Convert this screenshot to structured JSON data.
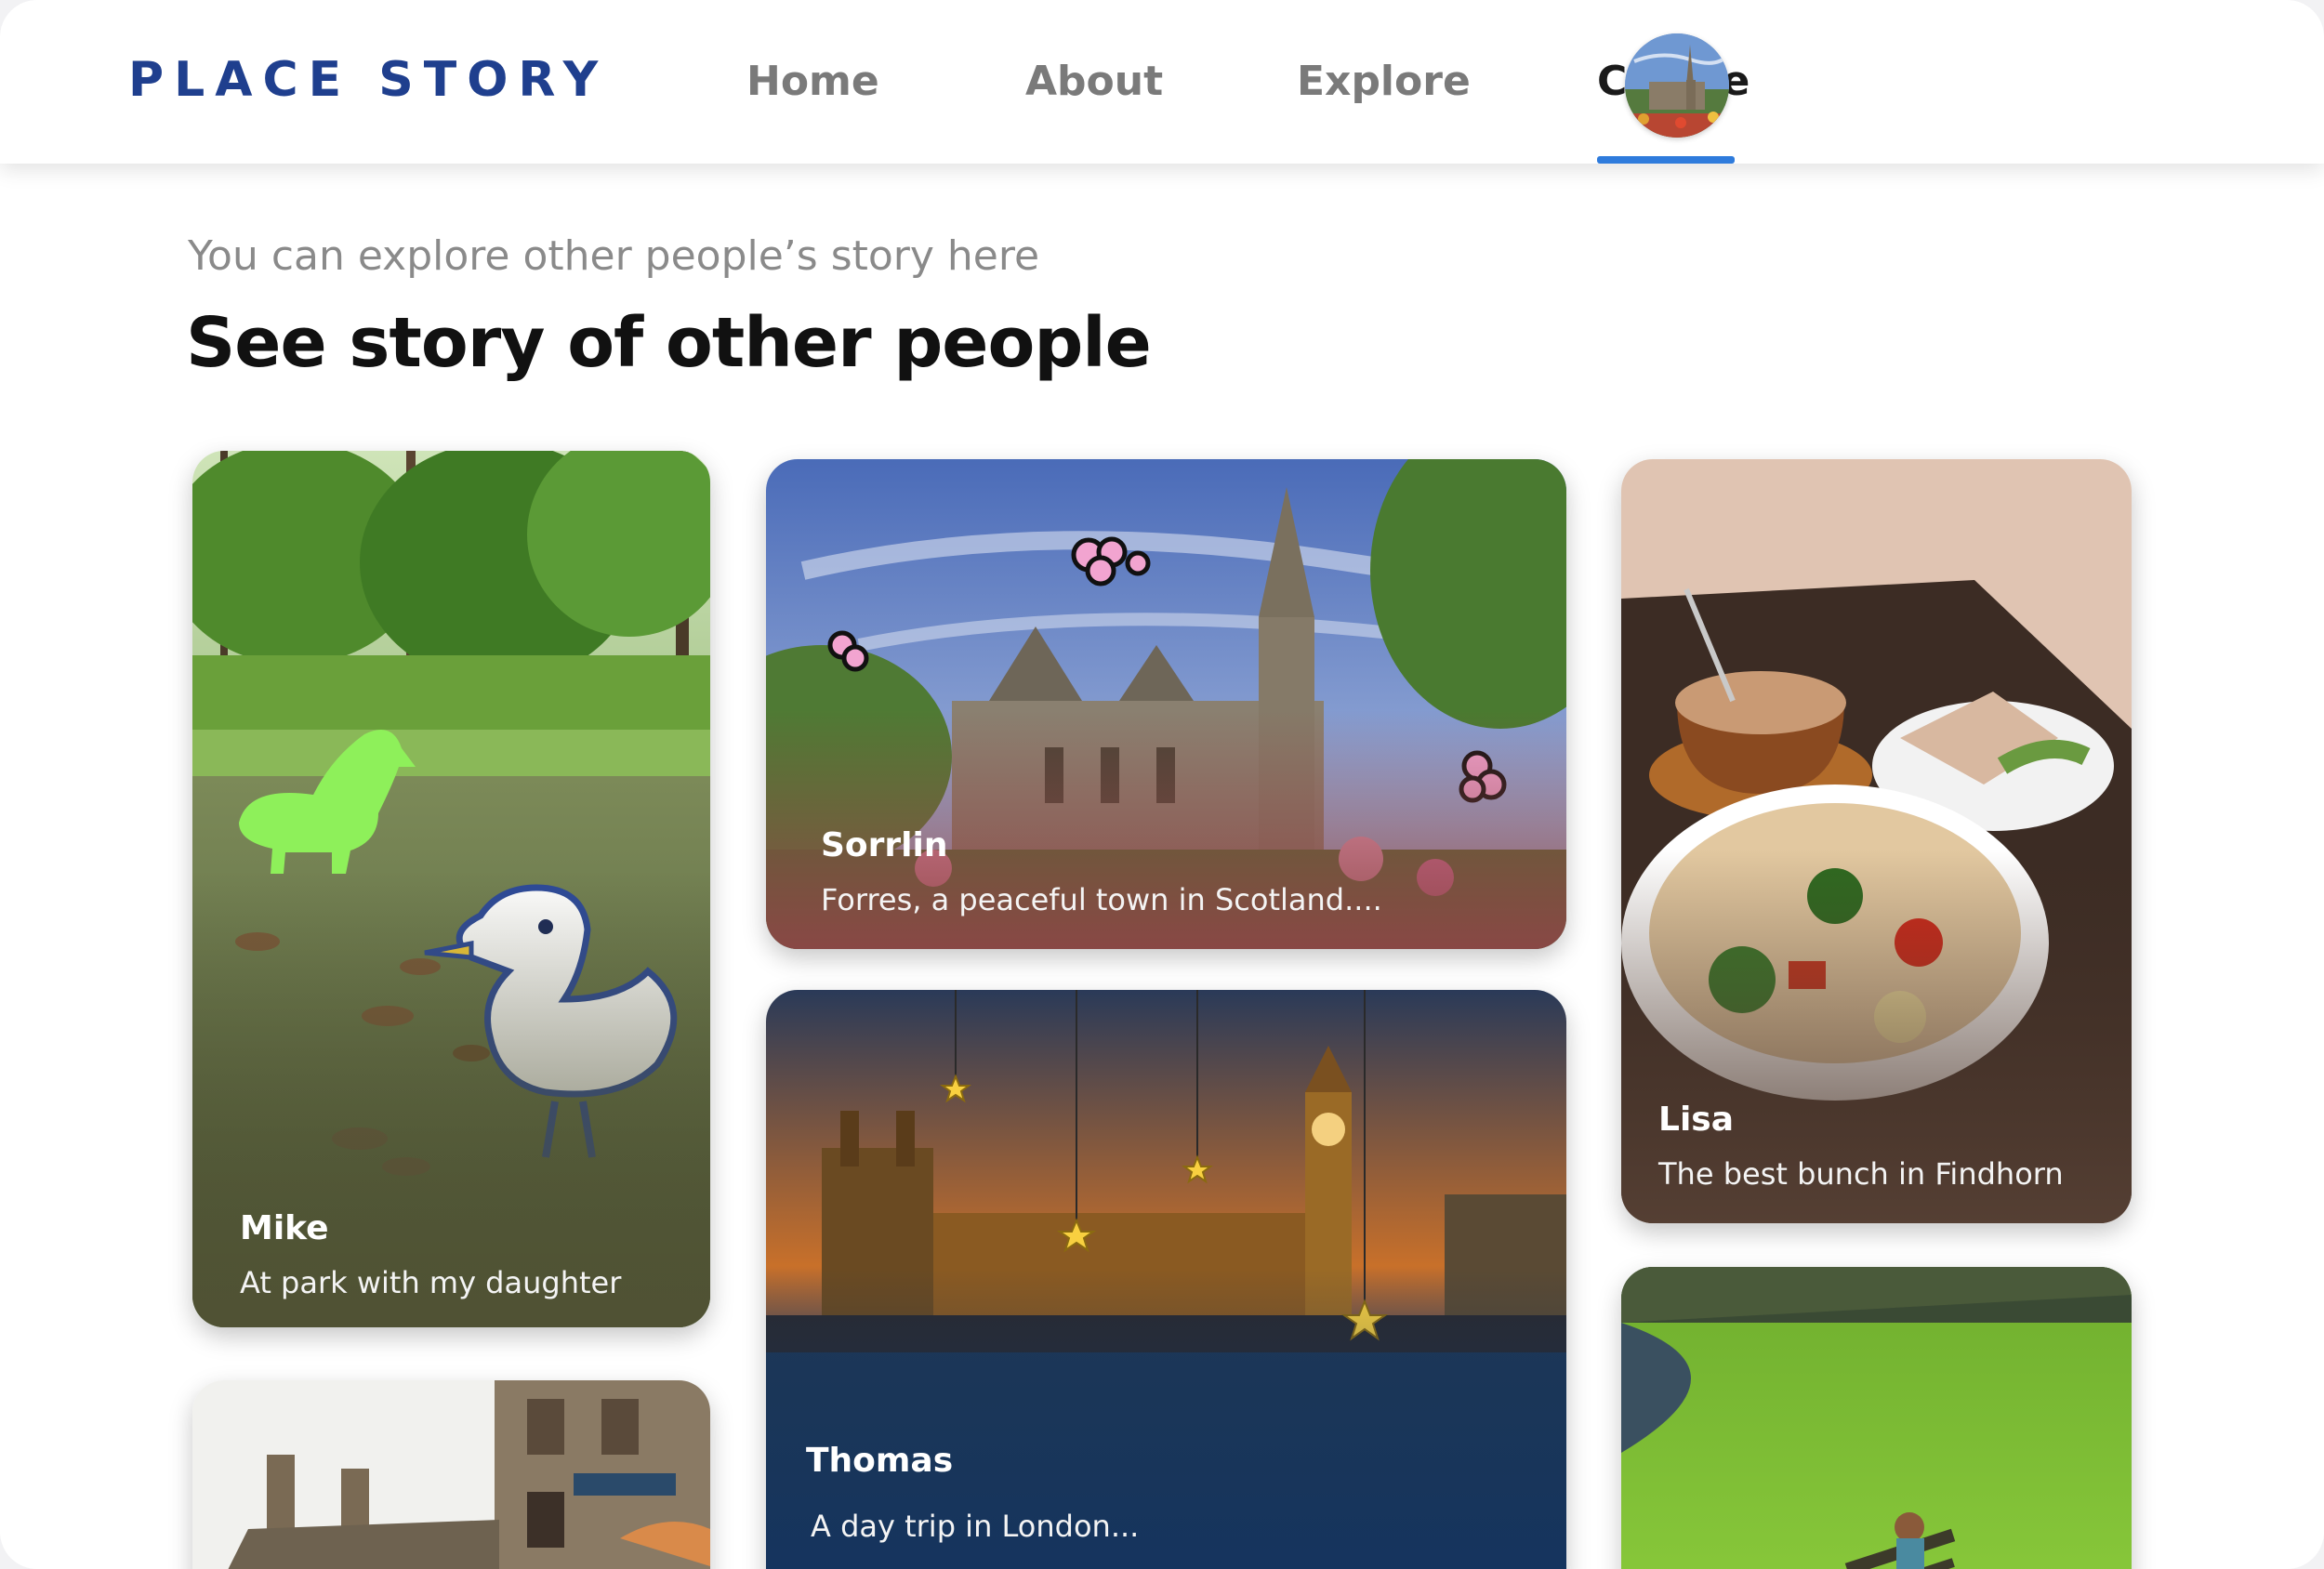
{
  "app": {
    "logo": "PLACE STORY"
  },
  "nav": {
    "items": [
      {
        "label": "Home",
        "active": false
      },
      {
        "label": "About",
        "active": false
      },
      {
        "label": "Explore",
        "active": false
      },
      {
        "label": "Create",
        "active": true
      }
    ],
    "accent_color": "#2e7bdc",
    "logo_color": "#1f3f8e"
  },
  "page": {
    "subtitle": "You can explore other people’s story here",
    "title": "See story of other people"
  },
  "stories": [
    {
      "author": "Mike",
      "caption": "At park with my daughter",
      "image": "duck-pond-photo"
    },
    {
      "author": "Sorrlin",
      "caption": "Forres, a peaceful town in Scotland....",
      "image": "cathedral-photo"
    },
    {
      "author": "Lisa",
      "caption": "The best bunch in Findhorn",
      "image": "lunch-table-photo"
    },
    {
      "author": "Thomas",
      "caption": "A day trip in London...",
      "image": "london-parliament-photo"
    },
    {
      "author": "",
      "caption": "",
      "image": "old-town-street-photo"
    },
    {
      "author": "",
      "caption": "",
      "image": "green-park-bench-photo"
    }
  ]
}
